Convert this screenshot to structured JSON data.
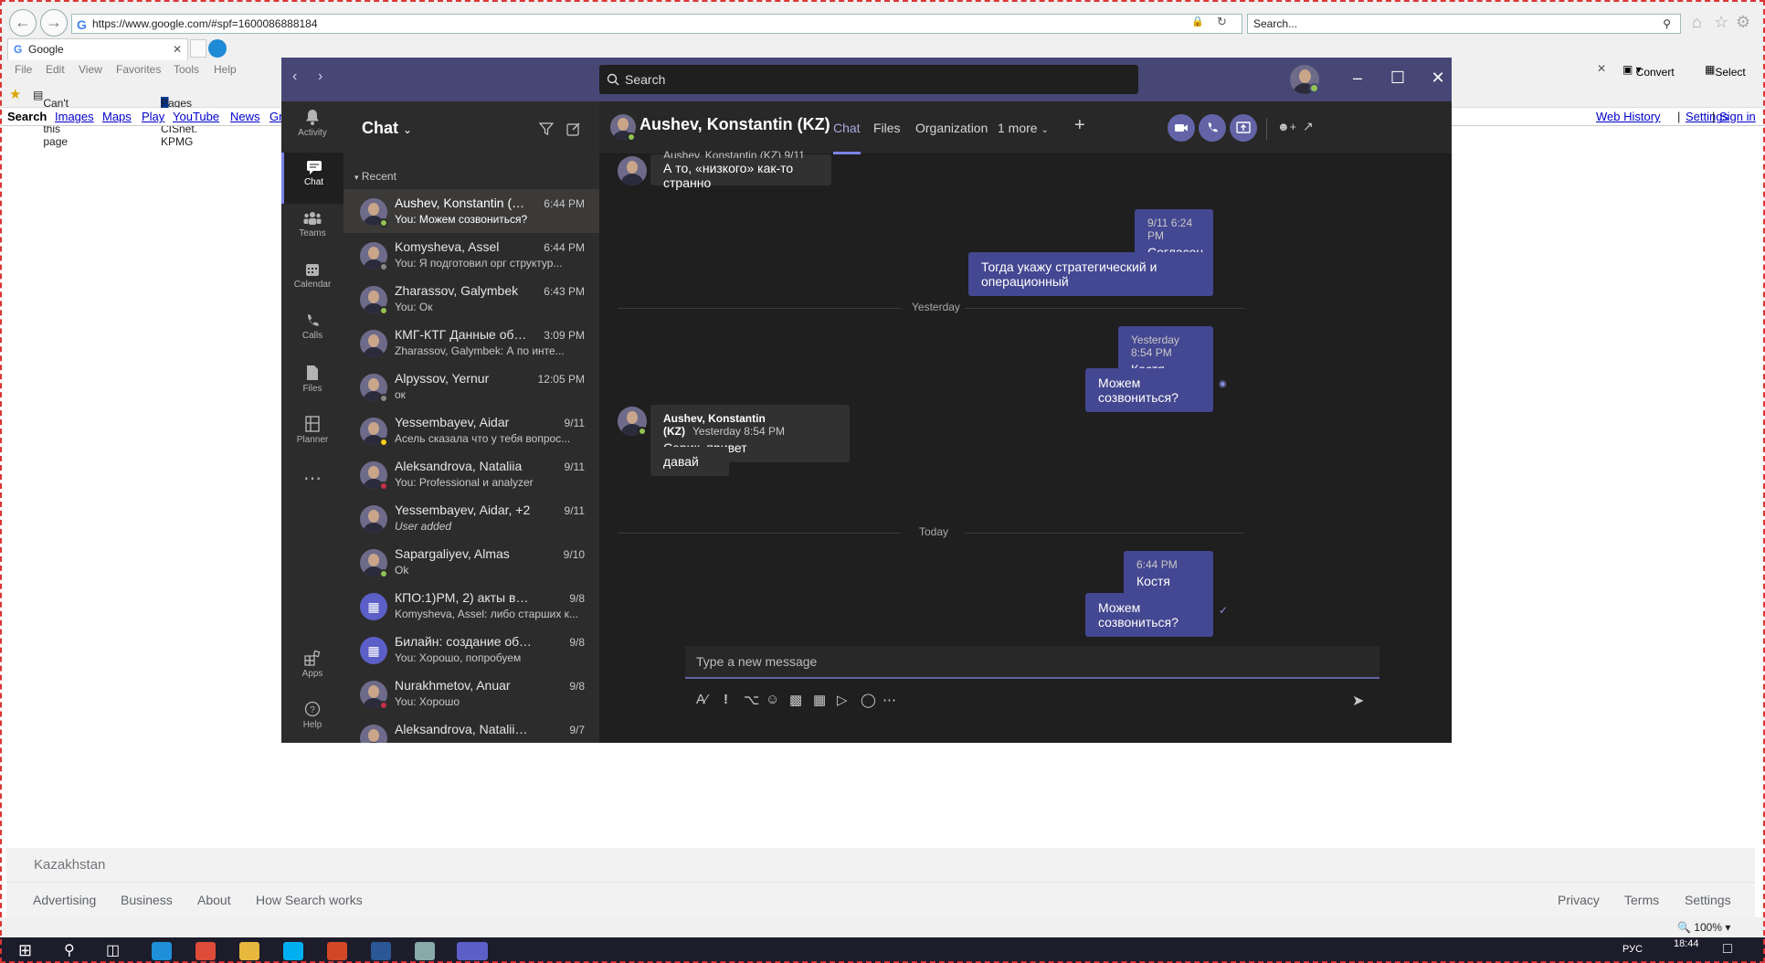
{
  "ie": {
    "address": "https://www.google.com/#spf=1600086888184",
    "search_placeholder": "Search...",
    "tab_title": "Google",
    "menu": [
      "File",
      "Edit",
      "View",
      "Favorites",
      "Tools",
      "Help"
    ],
    "fav1": "Can't reach this page",
    "fav2": "Pages - CISnet. KPMG",
    "convert": "Convert",
    "select": "Select",
    "google_links": [
      "Search",
      "Images",
      "Maps",
      "Play",
      "YouTube",
      "News",
      "Gr"
    ],
    "right_links": [
      "Web History",
      "Settings",
      "Sign in"
    ],
    "footer_country": "Kazakhstan",
    "footer_left": [
      "Advertising",
      "Business",
      "About",
      "How Search works"
    ],
    "footer_right": [
      "Privacy",
      "Terms",
      "Settings"
    ],
    "zoom": "100%",
    "clock_time": "18:44",
    "clock_lang": "РУС"
  },
  "teams": {
    "search_placeholder": "Search",
    "rail": [
      {
        "label": "Activity",
        "icon": "bell-icon"
      },
      {
        "label": "Chat",
        "icon": "chat-icon"
      },
      {
        "label": "Teams",
        "icon": "teams-icon"
      },
      {
        "label": "Calendar",
        "icon": "calendar-icon"
      },
      {
        "label": "Calls",
        "icon": "phone-icon"
      },
      {
        "label": "Files",
        "icon": "file-icon"
      },
      {
        "label": "Planner",
        "icon": "planner-icon"
      }
    ],
    "rail_apps": "Apps",
    "rail_help": "Help",
    "chat_title": "Chat",
    "recent": "Recent",
    "chats": [
      {
        "name": "Aushev, Konstantin (KZ)",
        "time": "6:44 PM",
        "preview": "You: Можем созвониться?",
        "status": "#92c353"
      },
      {
        "name": "Komysheva, Assel",
        "time": "6:44 PM",
        "preview": "You: Я подготовил орг структур...",
        "status": "#8a8886"
      },
      {
        "name": "Zharassov, Galymbek",
        "time": "6:43 PM",
        "preview": "You: Ок",
        "status": "#92c353"
      },
      {
        "name": "КМГ-КТГ Данные обсу...",
        "time": "3:09 PM",
        "preview": "Zharassov, Galymbek: А по инте...",
        "status": ""
      },
      {
        "name": "Alpyssov, Yernur",
        "time": "12:05 PM",
        "preview": "ок",
        "status": "#8a8886"
      },
      {
        "name": "Yessembayev, Aidar",
        "time": "9/11",
        "preview": "Асель сказала что у тебя вопрос...",
        "status": "#fcd116"
      },
      {
        "name": "Aleksandrova, Nataliia",
        "time": "9/11",
        "preview": "You: Professional и analyzer",
        "status": "#c4314b"
      },
      {
        "name": "Yessembayev, Aidar, +2",
        "time": "9/11",
        "preview": "User added",
        "status": ""
      },
      {
        "name": "Sapargaliyev, Almas",
        "time": "9/10",
        "preview": "Ok",
        "status": "#92c353"
      },
      {
        "name": "КПО:1)PM, 2) акты вып ра...",
        "time": "9/8",
        "preview": "Komysheva, Assel: либо старших к...",
        "status": ""
      },
      {
        "name": "Билайн: создание обучаю...",
        "time": "9/8",
        "preview": "You: Хорошо, попробуем",
        "status": ""
      },
      {
        "name": "Nurakhmetov, Anuar",
        "time": "9/8",
        "preview": "You: Хорошо",
        "status": "#c4314b"
      },
      {
        "name": "Aleksandrova, Nataliia, +2",
        "time": "9/7",
        "preview": "",
        "status": ""
      }
    ],
    "header_name": "Aushev, Konstantin (KZ)",
    "tabs": [
      "Chat",
      "Files",
      "Organization",
      "1 more"
    ],
    "messages": {
      "m0_meta": "Aushev, Konstantin (KZ)   9/11 6:24 PM",
      "m0_text": "А то, «низкого» как-то странно",
      "m1_meta": "9/11 6:24 PM",
      "m1_text": "Согласен",
      "m2_text": "Тогда укажу стратегический и операционный",
      "sep_yesterday": "Yesterday",
      "m3_meta": "Yesterday 8:54 PM",
      "m3_text": "Костя привет",
      "m4_text": "Можем созвониться?",
      "m5_author": "Aushev, Konstantin (KZ)",
      "m5_meta": "Yesterday 8:54 PM",
      "m5_text": "Серик, привет",
      "m6_text": "давай",
      "sep_today": "Today",
      "m7_meta": "6:44 PM",
      "m7_text": "Костя привет",
      "m8_text": "Можем созвониться?"
    },
    "compose_placeholder": "Type a new message"
  }
}
